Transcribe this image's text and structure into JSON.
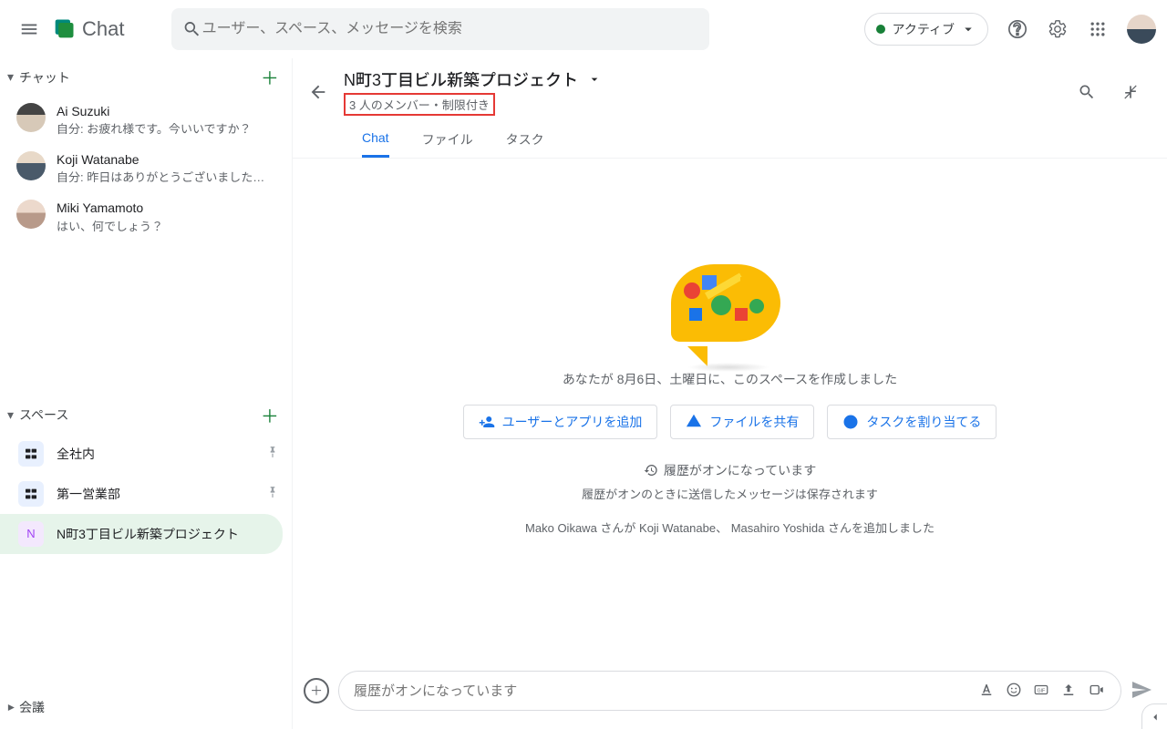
{
  "header": {
    "app_title": "Chat",
    "search_placeholder": "ユーザー、スペース、メッセージを検索",
    "status_label": "アクティブ"
  },
  "sidebar": {
    "section_chat": "チャット",
    "section_spaces": "スペース",
    "section_meet": "会議",
    "chats": [
      {
        "name": "Ai Suzuki",
        "preview": "自分: お疲れ様です。今いいですか？"
      },
      {
        "name": "Koji Watanabe",
        "preview": "自分: 昨日はありがとうございました…"
      },
      {
        "name": "Miki Yamamoto",
        "preview": "はい、何でしょう？"
      }
    ],
    "spaces": [
      {
        "name": "全社内",
        "letter": ""
      },
      {
        "name": "第一営業部",
        "letter": ""
      },
      {
        "name": "N町3丁目ビル新築プロジェクト",
        "letter": "N"
      }
    ]
  },
  "space": {
    "title": "N町3丁目ビル新築プロジェクト",
    "members_line": "3 人のメンバー・制限付き",
    "tabs": {
      "chat": "Chat",
      "files": "ファイル",
      "tasks": "タスク"
    },
    "created_text": "あなたが 8月6日、土曜日に、このスペースを作成しました",
    "actions": {
      "add_people": "ユーザーとアプリを追加",
      "share_file": "ファイルを共有",
      "assign_task": "タスクを割り当てる"
    },
    "history_on": "履歴がオンになっています",
    "history_desc": "履歴がオンのときに送信したメッセージは保存されます",
    "member_added": "Mako Oikawa さんが Koji Watanabe、 Masahiro Yoshida さんを追加しました"
  },
  "composer": {
    "placeholder": "履歴がオンになっています"
  }
}
